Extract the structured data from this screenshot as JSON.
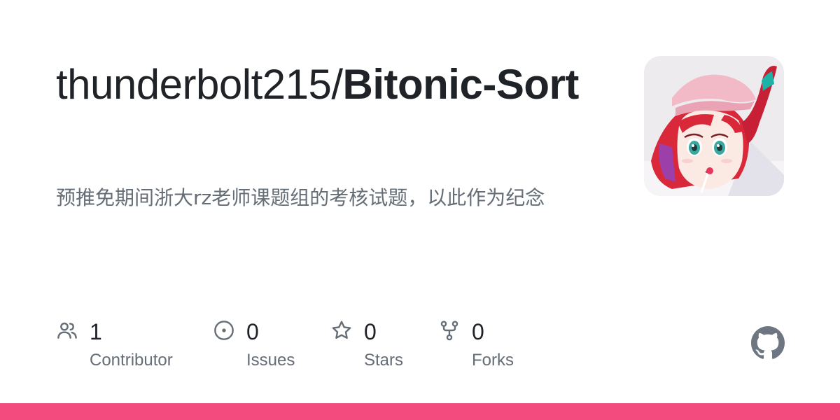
{
  "repo": {
    "owner_path": "thunderbolt215/",
    "name": "Bitonic-Sort",
    "description": "预推免期间浙大rz老师课题组的考核试题，以此作为纪念"
  },
  "stats": [
    {
      "icon": "people-icon",
      "count": "1",
      "label": "Contributor"
    },
    {
      "icon": "issue-opened-icon",
      "count": "0",
      "label": "Issues"
    },
    {
      "icon": "star-icon",
      "count": "0",
      "label": "Stars"
    },
    {
      "icon": "repo-forked-icon",
      "count": "0",
      "label": "Forks"
    }
  ],
  "avatar": {
    "icon": "owner-avatar-anime-girl"
  },
  "brand": {
    "icon": "github-mark-icon"
  },
  "colors": {
    "accent_bar": "#f34b7d",
    "title": "#1f2328",
    "muted": "#656d76",
    "github_mark": "#6e7681"
  }
}
